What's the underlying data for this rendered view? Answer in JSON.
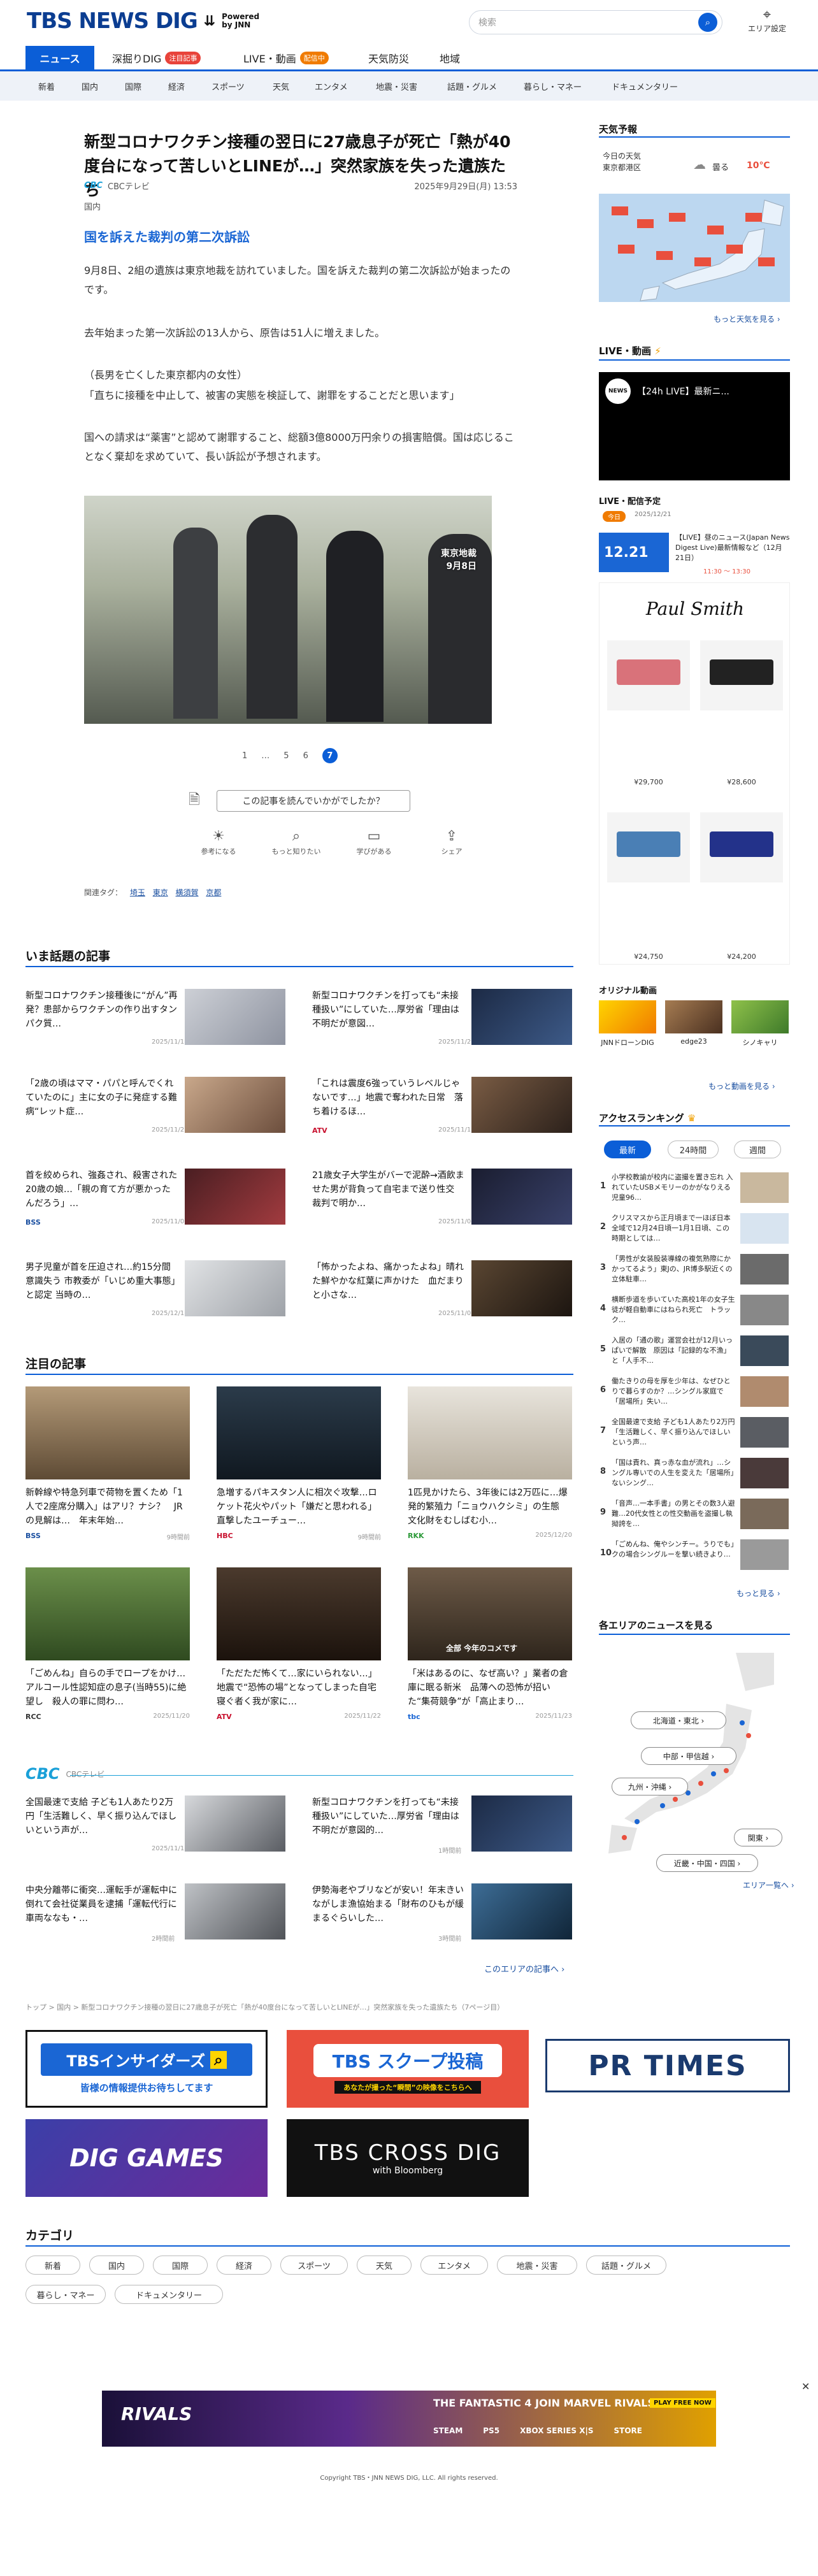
{
  "header": {
    "logo_main": "TBS NEWS DIG",
    "logo_powered": "Powered",
    "logo_by": "by JNN",
    "search_placeholder": "検索",
    "area_label": "エリア設定"
  },
  "nav_main": [
    {
      "label": "ニュース",
      "active": true
    },
    {
      "label": "深掘りDIG",
      "badge": "注目記事"
    },
    {
      "label": "LIVE・動画",
      "badge": "配信中"
    },
    {
      "label": "天気防災"
    },
    {
      "label": "地域"
    }
  ],
  "nav_sub": [
    "新着",
    "国内",
    "国際",
    "経済",
    "スポーツ",
    "天気",
    "エンタメ",
    "地震・災害",
    "話題・グルメ",
    "暮らし・マネー",
    "ドキュメンタリー"
  ],
  "article": {
    "title": "新型コロナワクチン接種の翌日に27歳息子が死亡「熱が40度台になって苦しいとLINEが…」突然家族を失った遺族たち",
    "source": "CBCテレビ",
    "date": "2025年9月29日(月) 13:53",
    "category": "国内",
    "subheading": "国を訴えた裁判の第二次訴訟",
    "paragraphs": [
      "9月8日、2組の遺族は東京地裁を訪れていました。国を訴えた裁判の第二次訴訟が始まったのです。",
      "去年始まった第一次訴訟の13人から、原告は51人に増えました。",
      "（長男を亡くした東京都内の女性）",
      "「直ちに接種を中止して、被害の実態を検証して、謝罪をすることだと思います」",
      "国への請求は“薬害”と認めて謝罪すること、総額3億8000万円余りの損害賠償。国は応じることなく棄却を求めていて、長い訴訟が予想されます。"
    ],
    "photo_caption_1": "東京地裁",
    "photo_caption_2": "9月8日",
    "pages": [
      "1",
      "…",
      "5",
      "6",
      "7"
    ],
    "read_prompt": "この記事を読んでいかがでしたか？",
    "reactions": [
      "参考になる",
      "もっと知りたい",
      "学びがある",
      "シェア"
    ],
    "tags_label": "関連タグ：",
    "tags": [
      "埼玉",
      "東京",
      "横須賀",
      "京都"
    ]
  },
  "trending": {
    "title": "いま話題の記事",
    "items": [
      {
        "text": "新型コロナワクチン接種後に“がん”再発？患部からワクチンの作り出すタンパク質…",
        "date": "2025/11/13",
        "src": ""
      },
      {
        "text": "新型コロナワクチンを打っても“未接種扱い”にしていた…厚労省「理由は不明だが意図…",
        "date": "2025/11/29",
        "src": ""
      },
      {
        "text": "「2歳の頃はママ・パパと呼んでくれていたのに」主に女の子に発症する難病“レット症…",
        "date": "2025/11/23",
        "src": ""
      },
      {
        "text": "「これは震度6強っていうレベルじゃないです…」地震で奪われた日常　落ち着けるほ…",
        "date": "2025/11/13",
        "src": "ATV"
      },
      {
        "text": "首を絞められ、強姦され、殺害された20歳の娘…「親の育て方が悪かったんだろう」…",
        "date": "2025/11/03",
        "src": "BSS"
      },
      {
        "text": "21歳女子大学生がバーで泥酔→酒飲ませた男が背負って自宅まで送り性交　裁判で明か…",
        "date": "2025/11/04",
        "src": ""
      },
      {
        "text": "男子児童が首を圧迫され…約15分間意識失う 市教委が「いじめ重大事態」と認定 当時の…",
        "date": "2025/12/17",
        "src": ""
      },
      {
        "text": "「怖かったよね、痛かったよね」晴れた鮮やかな紅葉に声かけた　血だまりと小さな…",
        "date": "2025/11/07",
        "src": ""
      }
    ]
  },
  "featured": {
    "title": "注目の記事",
    "items": [
      {
        "text": "新幹線や特急列車で荷物を置くため「1人で2座席分購入」はアリ？ナシ？　JRの見解は…　年末年始…",
        "src": "BSS",
        "date": "9時間前"
      },
      {
        "text": "急増するパキスタン人に相次ぐ攻撃…ロケット花火やパット「嫌だと思われる」直撃したユーチュー…",
        "src": "HBC",
        "date": "9時間前"
      },
      {
        "text": "1匹見かけたら、3年後には2万匹に…爆発的繁殖力「ニョウハクシミ」の生態　文化財をむしばむ小…",
        "src": "RKK",
        "date": "2025/12/20"
      },
      {
        "text": "「ごめんね」自らの手でロープをかけ…アルコール性認知症の息子(当時55)に絶望し　殺人の罪に問わ…",
        "src": "RCC",
        "date": "2025/11/20"
      },
      {
        "text": "「ただただ怖くて…家にいられない…」地震で“恐怖の場”となってしまった自宅　寝ぐ者く我が家に…",
        "src": "ATV",
        "date": "2025/11/22"
      },
      {
        "text": "「米はあるのに、なぜ高い？」業者の倉庫に眠る新米　品薄への恐怖が招いた“集荷競争”が「高止まり…",
        "src": "tbc",
        "date": "2025/11/23"
      }
    ],
    "photo_caption": "全部 今年のコメです"
  },
  "cbc": {
    "logo": "CBC",
    "label": "CBCテレビ",
    "items": [
      {
        "text": "全国最速で支給 子ども1人あたり2万円「生活難しく、早く振り込んでほしいという声が…",
        "date": "2025/11/13"
      },
      {
        "text": "新型コロナワクチンを打っても“未接種扱い”にしていた…厚労省「理由は不明だが意図的…",
        "date": "1時間前"
      },
      {
        "text": "中央分離帯に衝突…運転手が運転中に倒れて会社従業員を逮捕「運転代行に車両ななも・…",
        "date": "2時間前"
      },
      {
        "text": "伊勢海老やブリなどが安い！年末きいながしま漁協始まる「財布のひもが緩まるぐらいした…",
        "date": "3時間前"
      }
    ],
    "more": "このエリアの記事へ ›"
  },
  "breadcrumb": "トップ > 国内 > 新型コロナワクチン接種の翌日に27歳息子が死亡「熱が40度台になって苦しいとLINEが…」突然家族を失った遺族たち（7ページ目）",
  "banners": [
    {
      "label": "TBSインサイダーズ",
      "sub": "皆様の情報提供お待ちしてます"
    },
    {
      "label": "TBS スクープ投稿",
      "sub": "あなたが撮った“瞬間”の映像をこちらへ"
    },
    {
      "label": "PR TIMES"
    },
    {
      "label": "DIG GAMES"
    },
    {
      "label": "TBS CROSS DIG",
      "sub": "with Bloomberg"
    }
  ],
  "categories": {
    "title": "カテゴリ",
    "items": [
      "新着",
      "国内",
      "国際",
      "経済",
      "スポーツ",
      "天気",
      "エンタメ",
      "地震・災害",
      "話題・グルメ",
      "暮らし・マネー",
      "ドキュメンタリー"
    ]
  },
  "sidebar": {
    "weather_title": "天気予報",
    "weather_place_1": "今日の天気",
    "weather_place_2": "東京都港区",
    "weather_status": "曇る",
    "weather_temp": "10℃",
    "weather_more": "もっと天気を見る ›",
    "live_title": "LIVE・動画",
    "live_video_title": "【24h LIVE】最新ニ...",
    "schedule_title": "LIVE・配信予定",
    "schedule_badge": "今日",
    "schedule_date": "2025/12/21",
    "schedule_thumb": "12.21",
    "schedule_text": "【LIVE】昼のニュース(Japan News Digest Live)最新情報など（12月21日）",
    "schedule_time": "11:30 ～ 13:30",
    "ad_brand": "Paul Smith",
    "ad_prices": [
      "¥29,700",
      "¥28,600",
      "¥24,750",
      "¥24,200"
    ],
    "orig_title": "オリジナル動画",
    "orig_items": [
      "JNNドローンDIG",
      "edge23",
      "シノキャリ"
    ],
    "orig_more": "もっと動画を見る ›",
    "rank_title": "アクセスランキング",
    "rank_tabs": [
      "最新",
      "24時間",
      "週間"
    ],
    "rank_items": [
      "小学校教諭が校内に盗撮を置き忘れ 入れていたUSBメモリーのかがなりえる　児童96…",
      "クリスマスから正月頃まで一ほぼ日本全域で12月24日頃一1月1日頃、この時期としては…",
      "「男性が女装股装導線の複気熟際にかかってるよう」東Jの、JR博多駅近くの立体駐車…",
      "横断歩道を歩いていた高校1年の女子生徒が軽自動車にはねられ死亡　トラック…",
      "入居の「通の歌」運営会社が12月いっぱいで解散　原因は「記録的な不漁」と「人手不…",
      "働たきりの母を厚を少年は、なぜひとりで暮らすのか？…シングル家庭で「居場所」失い…",
      "全国最速で支給 子ども1人あたり2万円「生活難しく、早く振り込んでほしいという声…",
      "「国は責れ、真っ赤な血が流れ」…シングル専いでの人生を変えた「居場所」ないシング…",
      "「音声…一本手書」の男とその数3人避難…20代女性との性交動画を盗撮し執拗誇を…",
      "「ごめんね、俺やシンチー。うりでも」クの場合シングルーを撃い続きより…"
    ],
    "rank_more": "もっと見る ›",
    "area_title": "各エリアのニュースを見る",
    "areas": [
      "北海道・東北 ›",
      "中部・甲信越 ›",
      "九州・沖縄 ›",
      "関東 ›",
      "近畿・中国・四国 ›"
    ],
    "area_more": "エリア一覧へ ›"
  },
  "bottom_ad": {
    "text": "THE FANTASTIC 4 JOIN MARVEL RIVALS!",
    "cta": "PLAY FREE NOW",
    "platforms": [
      "STEAM",
      "PS5",
      "XBOX SERIES X|S",
      "STORE"
    ],
    "close": "✕"
  },
  "footer": {
    "copyright": "Copyright TBS・JNN NEWS DIG, LLC. All rights reserved."
  }
}
